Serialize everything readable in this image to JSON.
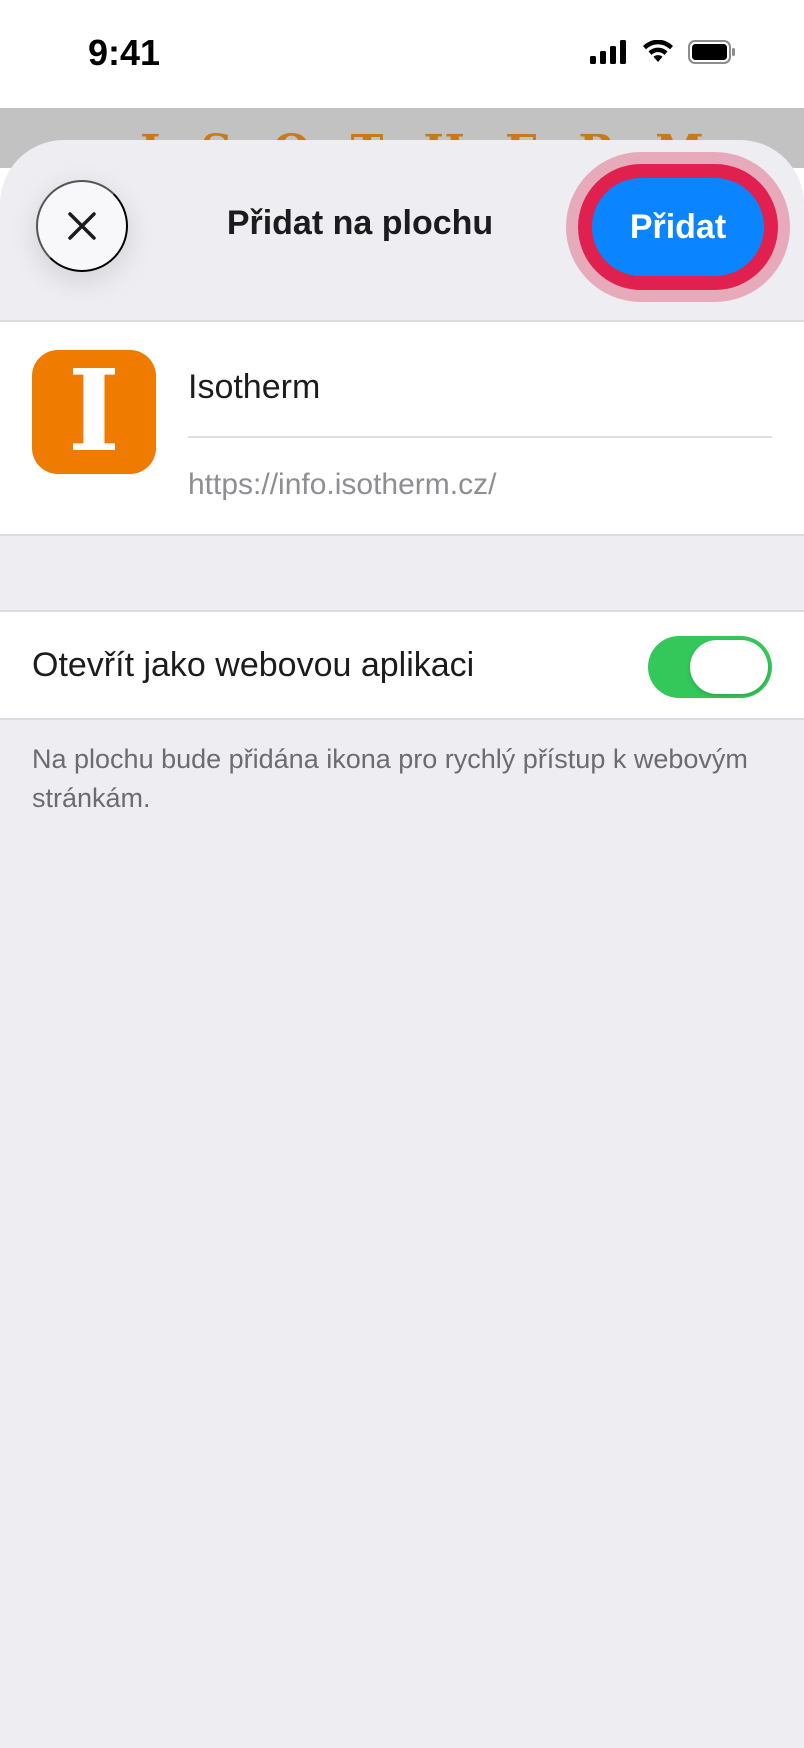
{
  "status_bar": {
    "time": "9:41",
    "icons": [
      "cellular-signal-icon",
      "wifi-icon",
      "battery-icon"
    ]
  },
  "backdrop": {
    "partial_text": "ISOTHERM"
  },
  "sheet": {
    "title": "Přidat na plochu",
    "close_icon": "close-icon",
    "add_label": "Přidat"
  },
  "app": {
    "icon_letter": "I",
    "name": "Isotherm",
    "url": "https://info.isotherm.cz/"
  },
  "option": {
    "label": "Otevřít jako webovou aplikaci",
    "enabled": true
  },
  "footnote": "Na plochu bude přidána ikona pro rychlý přístup k webovým stránkám.",
  "colors": {
    "accent": "#0a84ff",
    "highlight": "#e0214f",
    "toggle_on": "#34c759",
    "app_icon_bg": "#ef7b00",
    "sheet_bg": "#eeedf2"
  }
}
